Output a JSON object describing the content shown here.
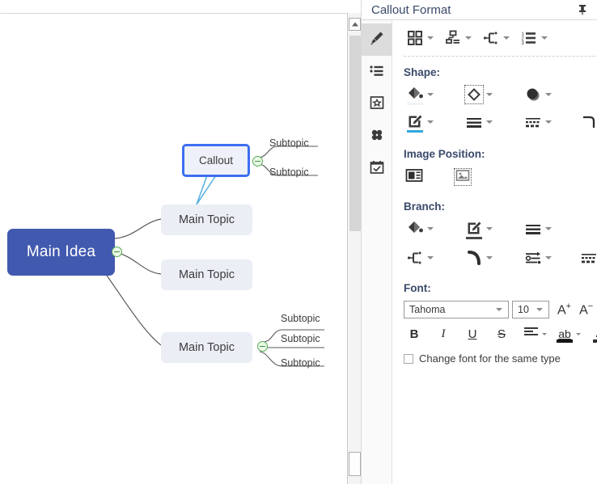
{
  "panel": {
    "title": "Callout Format",
    "pin_icon": "pushpin-icon",
    "rail": [
      {
        "id": "style",
        "icon": "paint-brush-icon",
        "active": true
      },
      {
        "id": "outline",
        "icon": "bullet-list-icon",
        "active": false
      },
      {
        "id": "badge",
        "icon": "badge-in-frame-icon",
        "active": false
      },
      {
        "id": "clipart",
        "icon": "clover-icon",
        "active": false
      },
      {
        "id": "task",
        "icon": "calendar-check-icon",
        "active": false
      }
    ],
    "toolbar": [
      {
        "id": "layout",
        "icon": "four-squares-layout-icon",
        "caret": true
      },
      {
        "id": "structure",
        "icon": "org-chart-icon",
        "caret": true
      },
      {
        "id": "branch-style",
        "icon": "branch-connector-icon",
        "caret": true
      },
      {
        "id": "numbering",
        "icon": "numbered-list-icon",
        "caret": true
      }
    ],
    "shape": {
      "label": "Shape:",
      "row1": [
        {
          "id": "fill-color",
          "icon": "paint-bucket-icon",
          "caret": true,
          "underline": "#eef3f7"
        },
        {
          "id": "shape-type",
          "icon": "diamond-shape-icon",
          "caret": true,
          "selected": true
        },
        {
          "id": "shadow",
          "icon": "shadow-circle-icon",
          "caret": true
        }
      ],
      "row2": [
        {
          "id": "line-color",
          "icon": "pencil-edit-icon",
          "caret": true,
          "underline": "#2fa8dd"
        },
        {
          "id": "line-weight",
          "icon": "line-weight-icon",
          "caret": true
        },
        {
          "id": "line-dash",
          "icon": "dashed-line-icon",
          "caret": true
        },
        {
          "id": "corner-style",
          "icon": "rounded-corner-icon",
          "caret": true
        }
      ]
    },
    "image_position": {
      "label": "Image Position:",
      "items": [
        {
          "id": "image-left",
          "icon": "image-left-of-text-icon",
          "selected": false
        },
        {
          "id": "image-above",
          "icon": "image-only-icon",
          "selected": true
        }
      ]
    },
    "branch": {
      "label": "Branch:",
      "row1": [
        {
          "id": "branch-fill",
          "icon": "paint-bucket-icon",
          "caret": true
        },
        {
          "id": "branch-line-color",
          "icon": "pencil-edit-icon",
          "caret": true
        },
        {
          "id": "branch-weight",
          "icon": "line-weight-icon",
          "caret": true
        }
      ],
      "row2": [
        {
          "id": "branch-connector",
          "icon": "branch-connector-icon",
          "caret": true
        },
        {
          "id": "branch-curve",
          "icon": "curve-arc-icon",
          "caret": true
        },
        {
          "id": "branch-arrow",
          "icon": "arrow-settings-icon",
          "caret": true
        },
        {
          "id": "branch-dash",
          "icon": "dashed-line-icon",
          "caret": true
        }
      ]
    },
    "font": {
      "label": "Font:",
      "family": "Tahoma",
      "size": "10",
      "grow_label": "A",
      "grow_sup": "+",
      "shrink_label": "A",
      "shrink_sup": "−",
      "buttons": [
        {
          "id": "bold",
          "glyph": "B",
          "icon": "bold-icon"
        },
        {
          "id": "italic",
          "glyph": "I",
          "icon": "italic-icon"
        },
        {
          "id": "underline",
          "glyph": "U",
          "icon": "underline-icon"
        },
        {
          "id": "strikethrough",
          "glyph": "S",
          "icon": "strikethrough-icon"
        },
        {
          "id": "align",
          "glyph": "",
          "icon": "align-left-icon",
          "caret": true
        },
        {
          "id": "highlight",
          "glyph": "ab",
          "icon": "text-highlight-icon",
          "caret": true
        },
        {
          "id": "font-color",
          "glyph": "A",
          "icon": "font-color-icon",
          "caret": true
        },
        {
          "id": "text-box",
          "glyph": "",
          "icon": "text-list-box-icon"
        }
      ],
      "checkbox_label": "Change font for the same type",
      "checkbox_checked": false
    }
  },
  "canvas": {
    "nodes": {
      "main_idea": "Main Idea",
      "main_topic_1": "Main Topic",
      "main_topic_2": "Main Topic",
      "main_topic_3": "Main Topic",
      "callout": "Callout"
    },
    "subtopics": {
      "t1": "Subtopic",
      "t2": "Subtopic",
      "b1": "Subtopic",
      "b2": "Subtopic",
      "b3": "Subtopic"
    },
    "colors": {
      "main_idea_fill": "#4159ae",
      "topic_fill": "#eceef6",
      "selection_border": "#3c6ff0",
      "callout_outline": "#58b4e0",
      "handle": "#57a957",
      "branch_line": "#5a5a5a"
    },
    "scrollbar": {
      "up_arrow_icon": "scroll-up-arrow-icon",
      "thumb_icon": "scroll-thumb"
    }
  }
}
